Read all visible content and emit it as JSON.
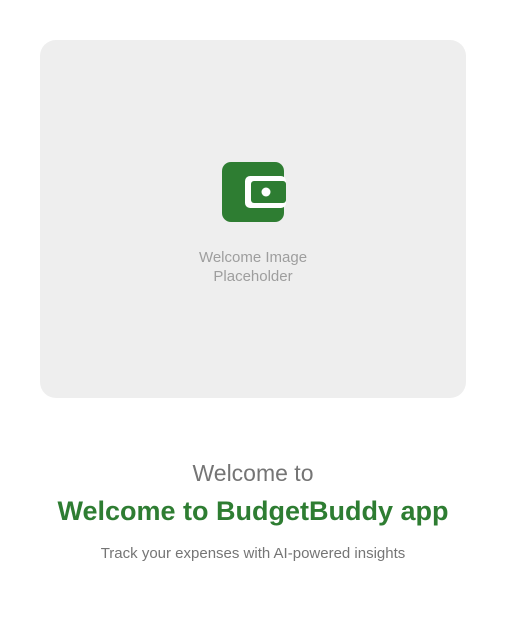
{
  "welcome_image": {
    "icon": "wallet-icon",
    "placeholder_line1": "Welcome Image",
    "placeholder_line2": "Placeholder"
  },
  "welcome": {
    "prefix": "Welcome to",
    "title": "Welcome to BudgetBuddy app",
    "subtitle": "Track your expenses with AI-powered insights"
  },
  "colors": {
    "brand_green": "#2e7d32",
    "card_background": "#eeeeee",
    "muted_text": "#757575",
    "placeholder_text": "#9e9e9e"
  }
}
